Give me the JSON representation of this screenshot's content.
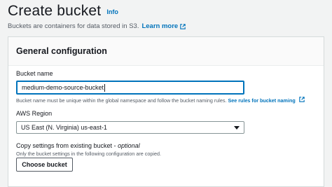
{
  "header": {
    "title": "Create bucket",
    "info": "Info",
    "subtitle": "Buckets are containers for data stored in S3.",
    "learn_more": "Learn more"
  },
  "panel": {
    "title": "General configuration",
    "bucket_name": {
      "label": "Bucket name",
      "value": "medium-demo-source-bucket",
      "hint": "Bucket name must be unique within the global namespace and follow the bucket naming rules.",
      "hint_link": "See rules for bucket naming"
    },
    "region": {
      "label": "AWS Region",
      "value": "US East (N. Virginia) us-east-1"
    },
    "copy_settings": {
      "label": "Copy settings from existing bucket - ",
      "optional": "optional",
      "hint": "Only the bucket settings in the following configuration are copied.",
      "button": "Choose bucket"
    }
  },
  "colors": {
    "link": "#0073bb",
    "focus_border": "#0073bb",
    "text": "#16191f",
    "muted": "#545b64"
  }
}
